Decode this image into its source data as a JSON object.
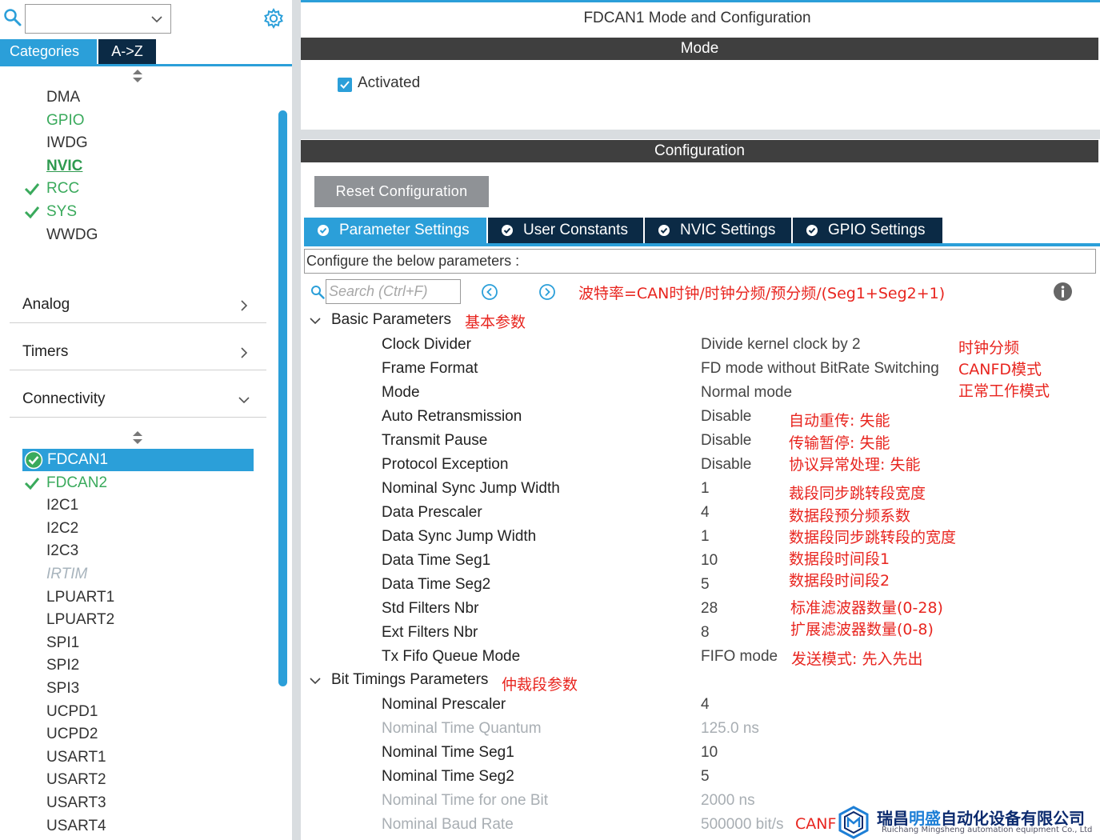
{
  "sidebar": {
    "category_combo_value": "",
    "tabs": {
      "categories": "Categories",
      "az": "A->Z"
    },
    "system_items": [
      {
        "label": "DMA",
        "state": "normal",
        "checked": false
      },
      {
        "label": "GPIO",
        "state": "green",
        "checked": false
      },
      {
        "label": "IWDG",
        "state": "normal",
        "checked": false
      },
      {
        "label": "NVIC",
        "state": "bold",
        "checked": false
      },
      {
        "label": "RCC",
        "state": "green",
        "checked": true
      },
      {
        "label": "SYS",
        "state": "green",
        "checked": true
      },
      {
        "label": "WWDG",
        "state": "normal",
        "checked": false
      }
    ],
    "sections": [
      "Analog",
      "Timers",
      "Connectivity"
    ],
    "connectivity_items": [
      {
        "label": "FDCAN1",
        "state": "selected",
        "checked": true
      },
      {
        "label": "FDCAN2",
        "state": "green",
        "checked": true
      },
      {
        "label": "I2C1",
        "state": "normal",
        "checked": false
      },
      {
        "label": "I2C2",
        "state": "normal",
        "checked": false
      },
      {
        "label": "I2C3",
        "state": "normal",
        "checked": false
      },
      {
        "label": "IRTIM",
        "state": "disabled",
        "checked": false
      },
      {
        "label": "LPUART1",
        "state": "normal",
        "checked": false
      },
      {
        "label": "LPUART2",
        "state": "normal",
        "checked": false
      },
      {
        "label": "SPI1",
        "state": "normal",
        "checked": false
      },
      {
        "label": "SPI2",
        "state": "normal",
        "checked": false
      },
      {
        "label": "SPI3",
        "state": "normal",
        "checked": false
      },
      {
        "label": "UCPD1",
        "state": "normal",
        "checked": false
      },
      {
        "label": "UCPD2",
        "state": "normal",
        "checked": false
      },
      {
        "label": "USART1",
        "state": "normal",
        "checked": false
      },
      {
        "label": "USART2",
        "state": "normal",
        "checked": false
      },
      {
        "label": "USART3",
        "state": "normal",
        "checked": false
      },
      {
        "label": "USART4",
        "state": "normal",
        "checked": false
      }
    ]
  },
  "main": {
    "title": "FDCAN1 Mode and Configuration",
    "mode_header": "Mode",
    "activated_label": "Activated",
    "activated_checked": true,
    "config_header": "Configuration",
    "reset_button": "Reset Configuration",
    "tabs": [
      {
        "label": "Parameter Settings",
        "active": true
      },
      {
        "label": "User Constants",
        "active": false
      },
      {
        "label": "NVIC Settings",
        "active": false
      },
      {
        "label": "GPIO Settings",
        "active": false
      }
    ],
    "configure_text": "Configure the below parameters :",
    "search_placeholder": "Search (Ctrl+F)",
    "formula_note": "波特率=CAN时钟/时钟分频/预分频/(Seg1+Seg2+1)",
    "basic_group": {
      "title": "Basic Parameters",
      "note": "基本参数"
    },
    "basic_params": [
      {
        "name": "Clock Divider",
        "value": "Divide kernel clock by 2"
      },
      {
        "name": "Frame Format",
        "value": "FD mode without BitRate Switching"
      },
      {
        "name": "Mode",
        "value": "Normal mode"
      },
      {
        "name": "Auto Retransmission",
        "value": "Disable"
      },
      {
        "name": "Transmit Pause",
        "value": "Disable"
      },
      {
        "name": "Protocol Exception",
        "value": "Disable"
      },
      {
        "name": "Nominal Sync Jump Width",
        "value": "1"
      },
      {
        "name": "Data Prescaler",
        "value": "4"
      },
      {
        "name": "Data Sync Jump Width",
        "value": "1"
      },
      {
        "name": "Data Time Seg1",
        "value": "10"
      },
      {
        "name": "Data Time Seg2",
        "value": "5"
      },
      {
        "name": "Std Filters Nbr",
        "value": "28"
      },
      {
        "name": "Ext Filters Nbr",
        "value": "8"
      },
      {
        "name": "Tx Fifo Queue Mode",
        "value": "FIFO mode"
      }
    ],
    "bit_group": {
      "title": "Bit Timings Parameters",
      "note": "仲裁段参数"
    },
    "bit_params": [
      {
        "name": "Nominal Prescaler",
        "value": "4",
        "dim": false
      },
      {
        "name": "Nominal Time Quantum",
        "value": "125.0 ns",
        "dim": true
      },
      {
        "name": "Nominal Time Seg1",
        "value": "10",
        "dim": false
      },
      {
        "name": "Nominal Time Seg2",
        "value": "5",
        "dim": false
      },
      {
        "name": "Nominal Time for one Bit",
        "value": "2000 ns",
        "dim": true
      },
      {
        "name": "Nominal Baud Rate",
        "value": "500000 bit/s",
        "dim": true
      }
    ],
    "annotations": {
      "clock_divider": "时钟分频",
      "frame_format": "CANFD模式",
      "mode": "正常工作模式",
      "auto_retx": "自动重传: 失能",
      "tx_pause": "传输暂停: 失能",
      "protocol_exc": "协议异常处理: 失能",
      "nominal_sjw": "裁段同步跳转段宽度",
      "data_prescaler": "数据段预分频系数",
      "data_sjw": "数据段同步跳转段的宽度",
      "data_seg1": "数据段时间段1",
      "data_seg2": "数据段时间段2",
      "std_filters": "标准滤波器数量(0-28)",
      "ext_filters": "扩展滤波器数量(0-8)",
      "tx_fifo": "发送模式: 先入先出",
      "baud_partial": "CANF"
    }
  },
  "watermark": {
    "name_part1": "瑞昌",
    "name_part2": "明盛",
    "name_part3": "自动化设备有限公司",
    "english": "Ruichang Mingsheng automation equipment Co., Ltd"
  },
  "colors": {
    "accent": "#2b9fd9",
    "dark_tab": "#0b2a45",
    "header_bar": "#3f3f3f",
    "annotation": "#e8251f",
    "ok_green": "#3aaa5c"
  }
}
